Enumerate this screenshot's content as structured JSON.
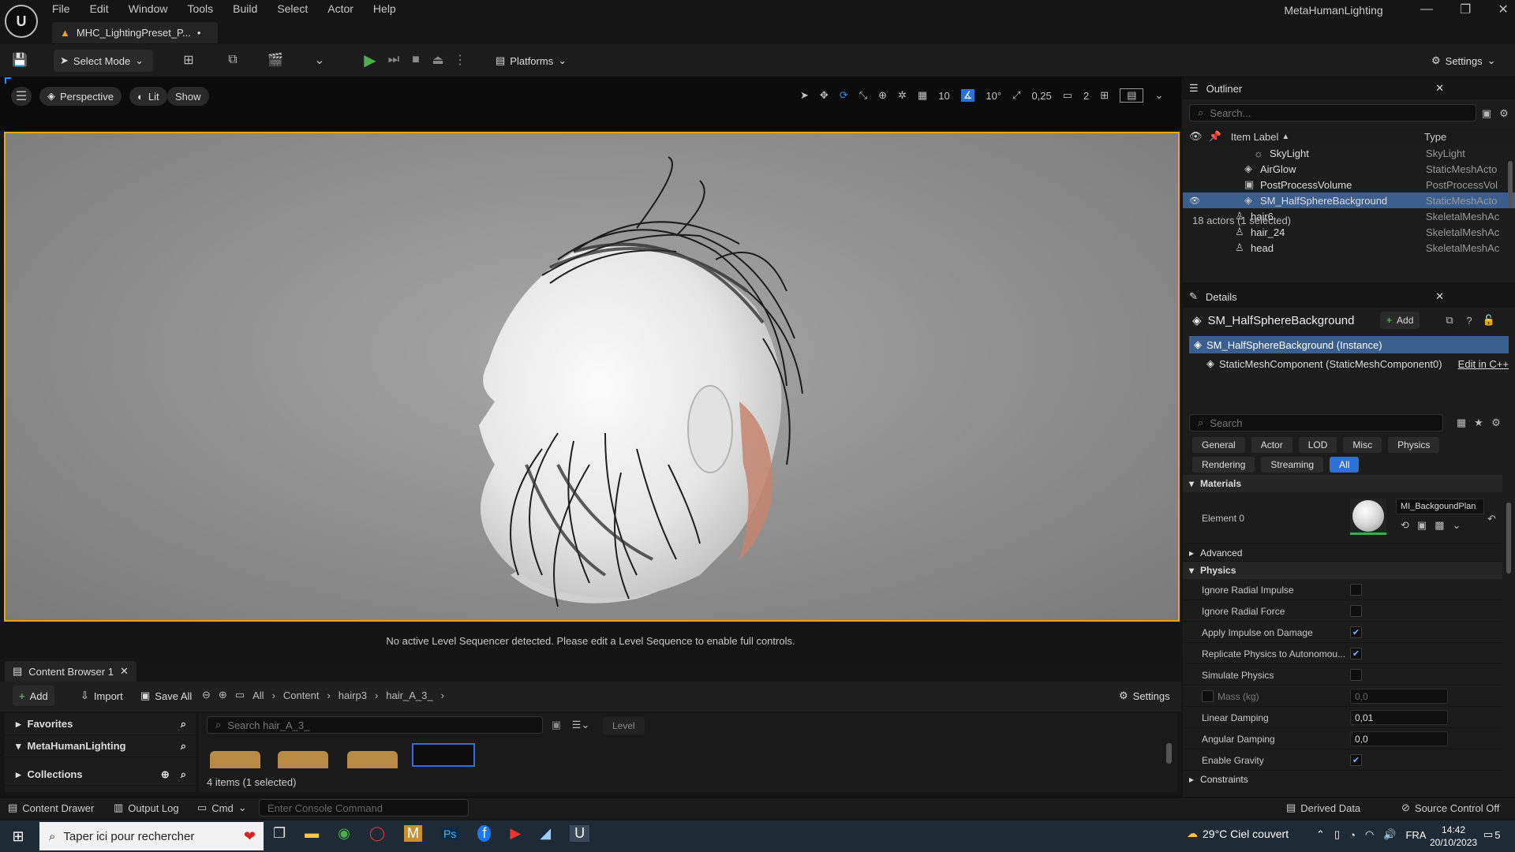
{
  "window": {
    "title": "MetaHumanLighting",
    "doc_tab": "MHC_LightingPreset_P...",
    "doc_tab_modified": "•"
  },
  "menu": [
    "File",
    "Edit",
    "Window",
    "Tools",
    "Build",
    "Select",
    "Actor",
    "Help"
  ],
  "toolbar": {
    "select_mode": "Select Mode",
    "platforms": "Platforms",
    "settings": "Settings"
  },
  "viewport": {
    "perspective": "Perspective",
    "lit": "Lit",
    "show": "Show",
    "grid_snap": "10",
    "rot_snap": "10°",
    "scale_snap": "0,25",
    "camera_speed": "2",
    "sequencer_msg": "No active Level Sequencer detected. Please edit a Level Sequence to enable full controls."
  },
  "outliner": {
    "title": "Outliner",
    "search_placeholder": "Search...",
    "col_label": "Item Label",
    "col_type": "Type",
    "rows": [
      {
        "label": "SkyLight",
        "type": "SkyLight"
      },
      {
        "label": "AirGlow",
        "type": "StaticMeshActo"
      },
      {
        "label": "PostProcessVolume",
        "type": "PostProcessVol"
      },
      {
        "label": "SM_HalfSphereBackground",
        "type": "StaticMeshActo"
      },
      {
        "label": "hair6",
        "type": "SkeletalMeshAc"
      },
      {
        "label": "hair_24",
        "type": "SkeletalMeshAc"
      },
      {
        "label": "head",
        "type": "SkeletalMeshAc"
      }
    ],
    "status": "18 actors (1 selected)"
  },
  "details": {
    "title": "Details",
    "object_name": "SM_HalfSphereBackground",
    "add": "Add",
    "instance": "SM_HalfSphereBackground (Instance)",
    "component": "StaticMeshComponent (StaticMeshComponent0)",
    "edit_cpp": "Edit in C++",
    "search_placeholder": "Search",
    "filters_row1": [
      "General",
      "Actor",
      "LOD",
      "Misc",
      "Physics"
    ],
    "filters_row2": [
      "Rendering",
      "Streaming",
      "All"
    ],
    "materials_section": "Materials",
    "element0": "Element 0",
    "material_name": "MI_BackgoundPlan",
    "advanced": "Advanced",
    "physics_section": "Physics",
    "physics": [
      {
        "label": "Ignore Radial Impulse",
        "checked": false
      },
      {
        "label": "Ignore Radial Force",
        "checked": false
      },
      {
        "label": "Apply Impulse on Damage",
        "checked": true
      },
      {
        "label": "Replicate Physics to Autonomou...",
        "checked": true
      },
      {
        "label": "Simulate Physics",
        "checked": false
      }
    ],
    "mass_label": "Mass (kg)",
    "mass_value": "0,0",
    "linear_damping_label": "Linear Damping",
    "linear_damping": "0,01",
    "angular_damping_label": "Angular Damping",
    "angular_damping": "0,0",
    "enable_gravity_label": "Enable Gravity",
    "constraints": "Constraints"
  },
  "content_browser": {
    "tab": "Content Browser 1",
    "add": "Add",
    "import": "Import",
    "save_all": "Save All",
    "breadcrumb": [
      "All",
      "Content",
      "hairp3",
      "hair_A_3_"
    ],
    "settings": "Settings",
    "favorites": "Favorites",
    "project": "MetaHumanLighting",
    "collections": "Collections",
    "search_placeholder": "Search hair_A_3_",
    "level_filter": "Level",
    "status": "4 items (1 selected)"
  },
  "bottombar": {
    "content_drawer": "Content Drawer",
    "output_log": "Output Log",
    "cmd": "Cmd",
    "console_placeholder": "Enter Console Command",
    "derived_data": "Derived Data",
    "source_control": "Source Control Off"
  },
  "taskbar": {
    "search": "Taper ici pour rechercher",
    "weather": "29°C  Ciel couvert",
    "lang": "FRA",
    "time": "14:42",
    "date": "20/10/2023",
    "notif": "5"
  }
}
